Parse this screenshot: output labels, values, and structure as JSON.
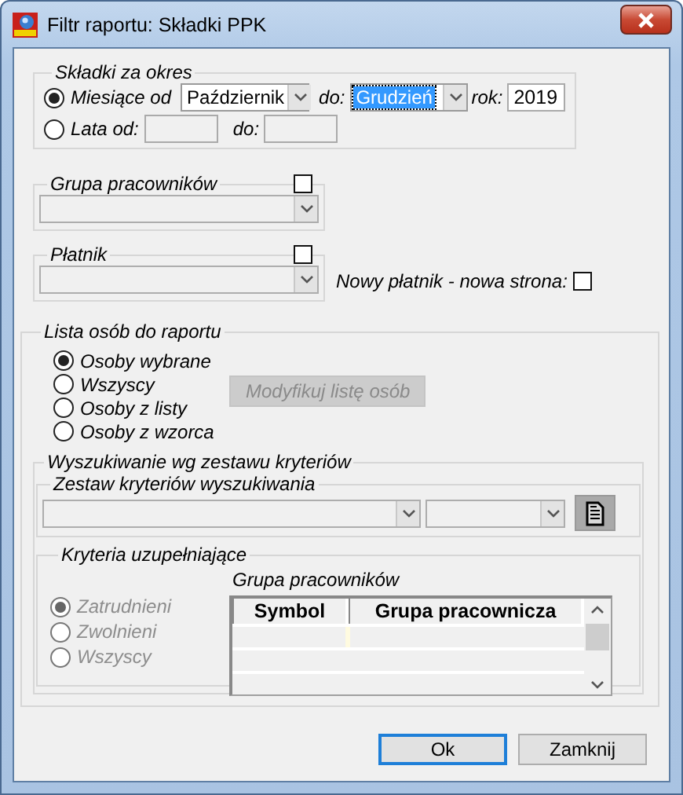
{
  "window": {
    "title": "Filtr raportu: Składki PPK"
  },
  "period": {
    "legend": "Składki za okres",
    "options": [
      {
        "label": "Miesiące od",
        "selected": true
      },
      {
        "label": "Lata od:",
        "selected": false
      }
    ],
    "month_from": "Październik",
    "to_label": "do:",
    "month_to": {
      "value": "Grudzień",
      "focused": true
    },
    "year_label": "rok:",
    "year": "2019",
    "years_to_label": "do:"
  },
  "employee_group": {
    "legend": "Grupa pracowników",
    "checked": false
  },
  "payer": {
    "legend": "Płatnik",
    "checked": false
  },
  "new_payer_new_page": {
    "label": "Nowy płatnik - nowa strona:",
    "checked": false
  },
  "person_list": {
    "legend": "Lista osób do raportu",
    "options": [
      {
        "label": "Osoby wybrane",
        "selected": true
      },
      {
        "label": "Wszyscy",
        "selected": false
      },
      {
        "label": "Osoby z listy",
        "selected": false
      },
      {
        "label": "Osoby z wzorca",
        "selected": false
      }
    ],
    "modify_button": {
      "label": "Modyfikuj listę osób",
      "disabled": true
    }
  },
  "search": {
    "legend": "Wyszukiwanie wg zestawu kryteriów",
    "criteria_set": {
      "legend": "Zestaw kryteriów wyszukiwania"
    },
    "supplementary": {
      "legend": "Kryteria uzupełniające",
      "disabled": true,
      "options": [
        {
          "label": "Zatrudnieni",
          "selected": true
        },
        {
          "label": "Zwolnieni",
          "selected": false
        },
        {
          "label": "Wszyscy",
          "selected": false
        }
      ],
      "grid_title": "Grupa pracowników",
      "columns": [
        "Symbol",
        "Grupa pracownicza"
      ]
    }
  },
  "buttons": [
    {
      "label": "Ok",
      "default": true
    },
    {
      "label": "Zamknij",
      "default": false
    }
  ]
}
